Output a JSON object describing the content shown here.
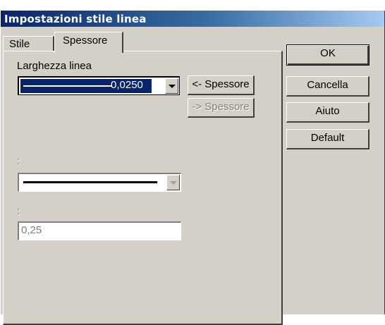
{
  "window": {
    "title": "Impostazioni stile linea"
  },
  "tabs": [
    {
      "label": "Stile",
      "selected": false
    },
    {
      "label": "Spessore",
      "selected": true
    }
  ],
  "panel": {
    "width_label": "Larghezza linea",
    "width_combo_value": "0,0250",
    "btn_from_label": "<- Spessore",
    "btn_to_label": "-> Spessore",
    "disabled_label_1": ":",
    "disabled_label_2": ":",
    "disabled_textbox_value": "0,25"
  },
  "buttons": {
    "ok": "OK",
    "cancel": "Cancella",
    "help": "Aiuto",
    "default": "Default"
  }
}
